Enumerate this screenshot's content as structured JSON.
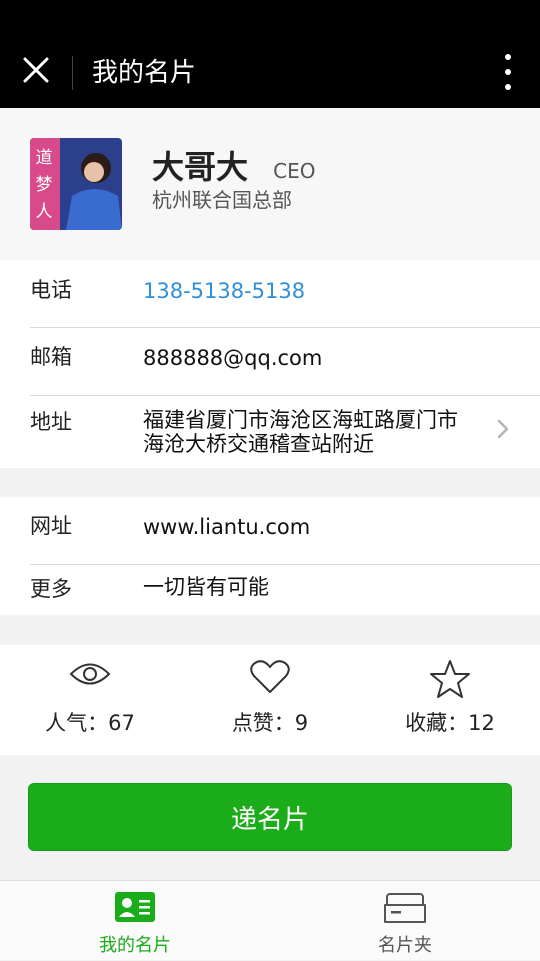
{
  "header": {
    "title": "我的名片"
  },
  "profile": {
    "avatar_text": [
      "道",
      "梦",
      "人"
    ],
    "name": "大哥大",
    "role": "CEO",
    "company": "杭州联合国总部"
  },
  "contact": {
    "phone_label": "电话",
    "phone_value": "138-5138-5138",
    "email_label": "邮箱",
    "email_value": "888888@qq.com",
    "address_label": "地址",
    "address_line1": "福建省厦门市海沧区海虹路厦门市",
    "address_line2": "海沧大桥交通稽查站附近"
  },
  "extra": {
    "website_label": "网址",
    "website_value": "www.liantu.com",
    "more_label": "更多",
    "more_value": "一切皆有可能"
  },
  "stats": {
    "views": "人气：67",
    "likes": "点赞：9",
    "favorites": "收藏：12"
  },
  "action": {
    "pass_card_label": "递名片"
  },
  "tabbar": {
    "tabs": [
      {
        "label": "我的名片",
        "active": true
      },
      {
        "label": "名片夹",
        "active": false
      }
    ]
  },
  "colors": {
    "accent_green": "#1aad19",
    "link_blue": "#2f8fd8"
  }
}
